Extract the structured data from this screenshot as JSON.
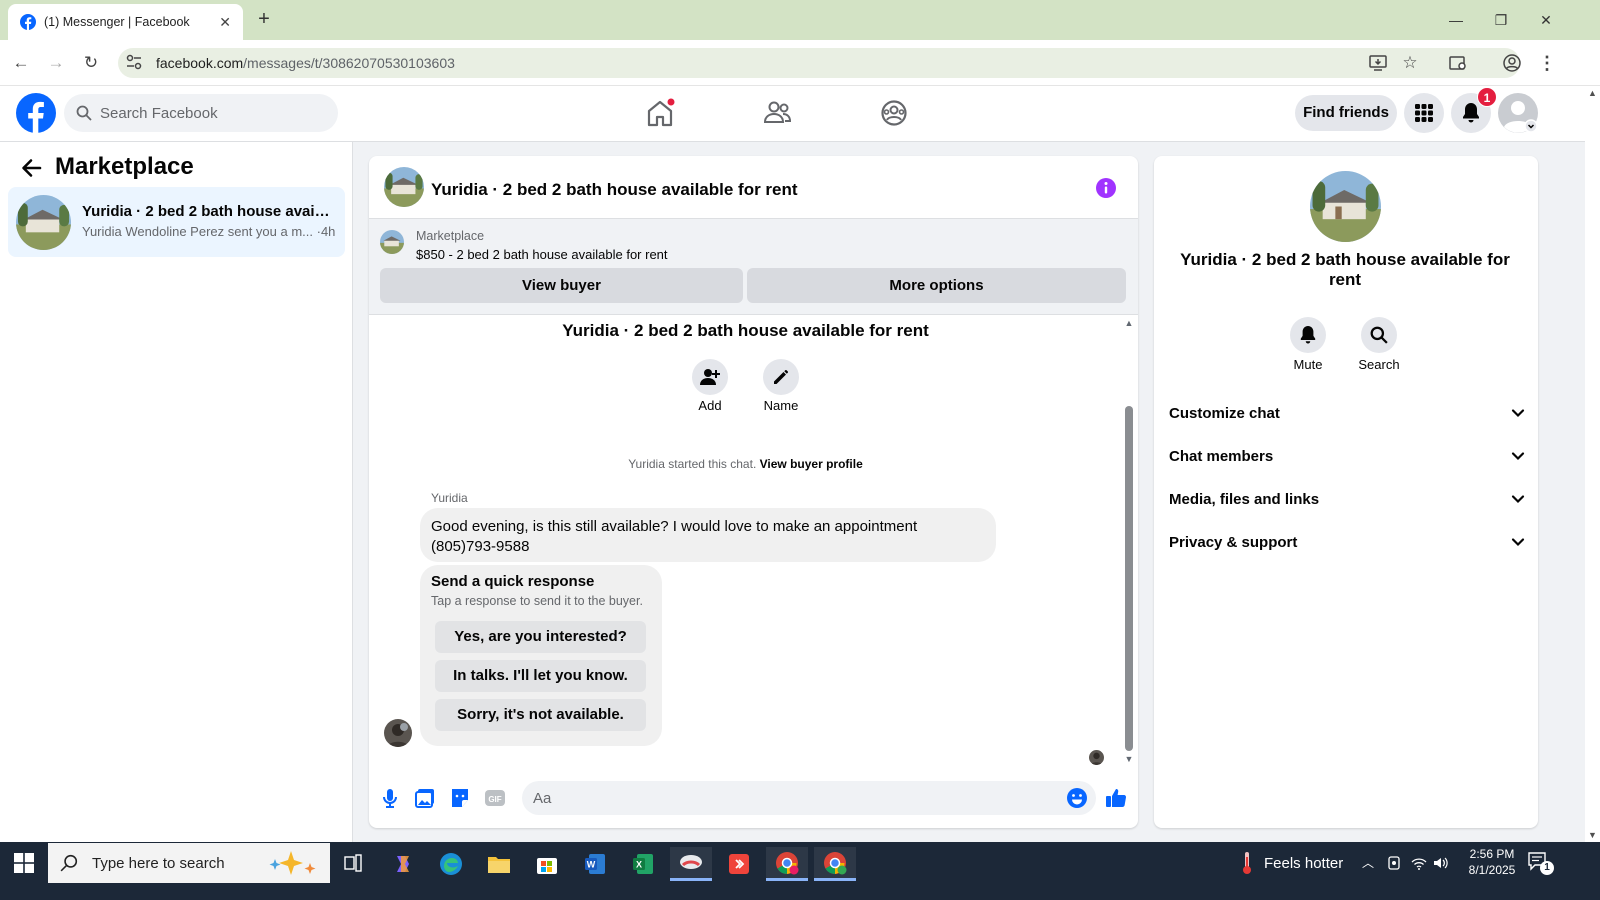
{
  "browser": {
    "tab_title": "(1) Messenger | Facebook",
    "url_domain": "facebook.com",
    "url_path": "/messages/t/30862070530103603",
    "new_tab": "+",
    "tab_close": "✕"
  },
  "header": {
    "search_placeholder": "Search Facebook",
    "find_friends": "Find friends",
    "notification_count": "1"
  },
  "left": {
    "title": "Marketplace",
    "conversation": {
      "name": "Yuridia · 2 bed 2 bath house availa...",
      "preview": "Yuridia Wendoline Perez sent you a m... ·4h"
    }
  },
  "chat": {
    "header_title": "Yuridia · 2 bed 2 bath house available for rent",
    "marketplace_label": "Marketplace",
    "listing": "$850 - 2 bed 2 bath house available for rent",
    "view_buyer": "View buyer",
    "more_options": "More options",
    "thread_title": "Yuridia · 2 bed 2 bath house available for rent",
    "actions": [
      {
        "label": "Add"
      },
      {
        "label": "Name"
      }
    ],
    "started_text": "Yuridia started this chat.",
    "started_link": "View buyer profile",
    "sender": "Yuridia",
    "message": "Good evening, is this still available? I would love to make an appointment (805)793-9588",
    "quick_title": "Send a quick response",
    "quick_sub": "Tap a response to send it to the buyer.",
    "quick_responses": [
      "Yes, are you interested?",
      "In talks. I'll let you know.",
      "Sorry, it's not available."
    ],
    "composer_placeholder": "Aa"
  },
  "right": {
    "name": "Yuridia · 2 bed 2 bath house available for rent",
    "mute": "Mute",
    "search": "Search",
    "sections": [
      "Customize chat",
      "Chat members",
      "Media, files and links",
      "Privacy & support"
    ]
  },
  "taskbar": {
    "search_placeholder": "Type here to search",
    "weather": "Feels hotter",
    "time": "2:56 PM",
    "date": "8/1/2025",
    "notifications": "1"
  },
  "colors": {
    "facebook_blue": "#0866ff",
    "messenger_purple": "#a033ff",
    "notification_red": "#e41e3f",
    "chrome_tabbar": "#d3e3c5"
  }
}
